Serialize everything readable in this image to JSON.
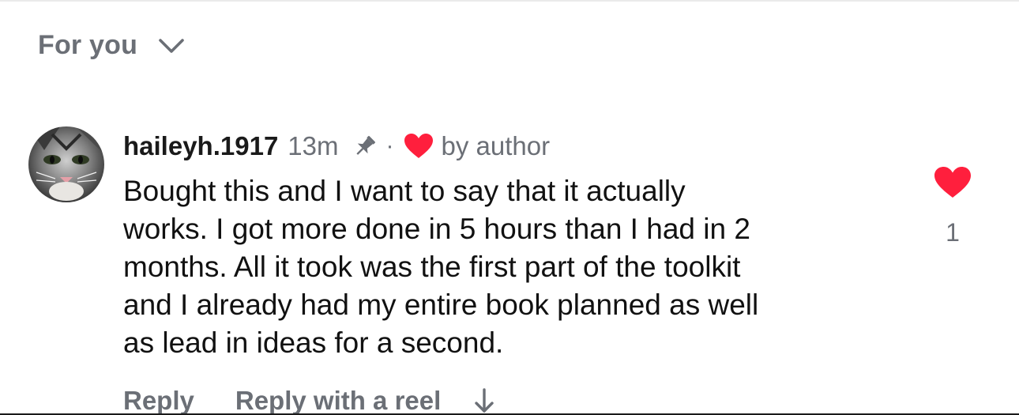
{
  "header": {
    "sort_label": "For you",
    "sort_icon": "chevron-down-icon"
  },
  "comment": {
    "username": "haileyh.1917",
    "time": "13m",
    "separator": "·",
    "by_author_label": "by author",
    "text": "Bought this and I want to say that it actually\nworks. I got more done in 5 hours than I had in 2\nmonths. All it took was the first part of the toolkit\nand I already had my entire book planned as well\nas lead in ideas for a second.",
    "icons": {
      "pin": "pin-icon",
      "author_heart": "heart-icon",
      "avatar": "cat-avatar"
    },
    "actions": {
      "reply_label": "Reply",
      "reply_reel_label": "Reply with a reel",
      "arrow_icon": "arrow-down-icon"
    },
    "like": {
      "count": "1",
      "icon": "heart-icon",
      "liked": true
    }
  },
  "colors": {
    "heart": "#ff1f3d",
    "muted_text": "#6b6f76",
    "primary_text": "#111111"
  }
}
